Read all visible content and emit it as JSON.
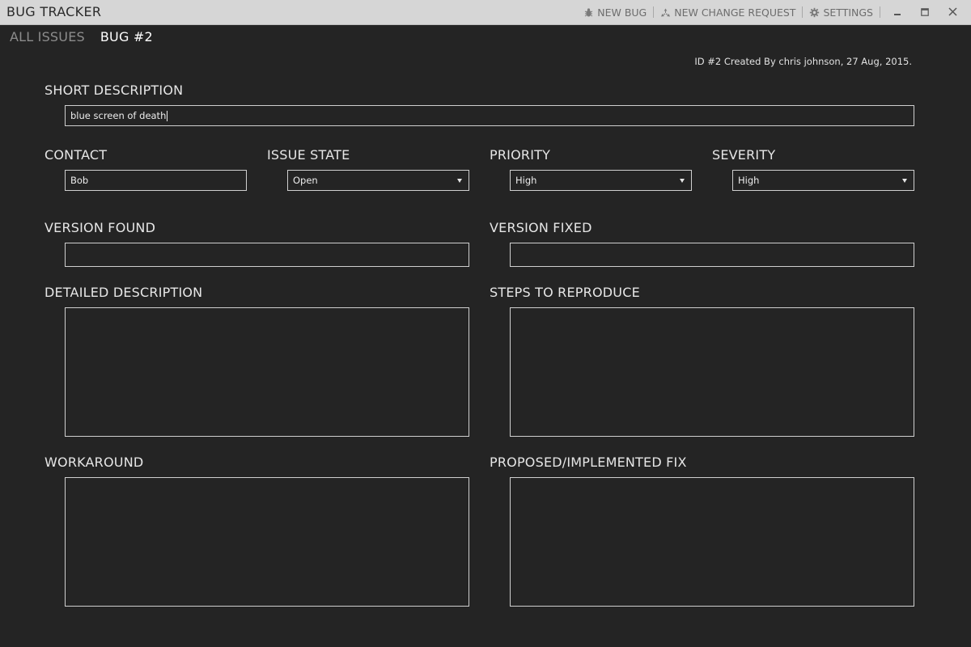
{
  "app": {
    "title": "BUG TRACKER"
  },
  "toolbar": {
    "new_bug": "NEW BUG",
    "new_change_request": "NEW CHANGE REQUEST",
    "settings": "SETTINGS"
  },
  "tabs": [
    {
      "label": "ALL ISSUES",
      "active": false
    },
    {
      "label": "BUG #2",
      "active": true
    }
  ],
  "meta": "ID #2 Created By chris johnson, 27 Aug, 2015.",
  "form": {
    "short_description": {
      "label": "SHORT DESCRIPTION",
      "value": "blue screen of death"
    },
    "contact": {
      "label": "CONTACT",
      "value": "Bob"
    },
    "issue_state": {
      "label": "ISSUE STATE",
      "value": "Open"
    },
    "priority": {
      "label": "PRIORITY",
      "value": "High"
    },
    "severity": {
      "label": "SEVERITY",
      "value": "High"
    },
    "version_found": {
      "label": "VERSION FOUND",
      "value": ""
    },
    "version_fixed": {
      "label": "VERSION FIXED",
      "value": ""
    },
    "detailed_description": {
      "label": "DETAILED DESCRIPTION",
      "value": ""
    },
    "steps_to_reproduce": {
      "label": "STEPS TO REPRODUCE",
      "value": ""
    },
    "workaround": {
      "label": "WORKAROUND",
      "value": ""
    },
    "proposed_fix": {
      "label": "PROPOSED/IMPLEMENTED FIX",
      "value": ""
    }
  },
  "icons": [
    "bug-icon",
    "change-request-icon",
    "gear-icon",
    "minimize-icon",
    "maximize-icon",
    "close-icon",
    "chevron-down-icon"
  ],
  "colors": {
    "background": "#242424",
    "titlebar": "#d6d6d6",
    "field_border": "#cfcfcf"
  }
}
